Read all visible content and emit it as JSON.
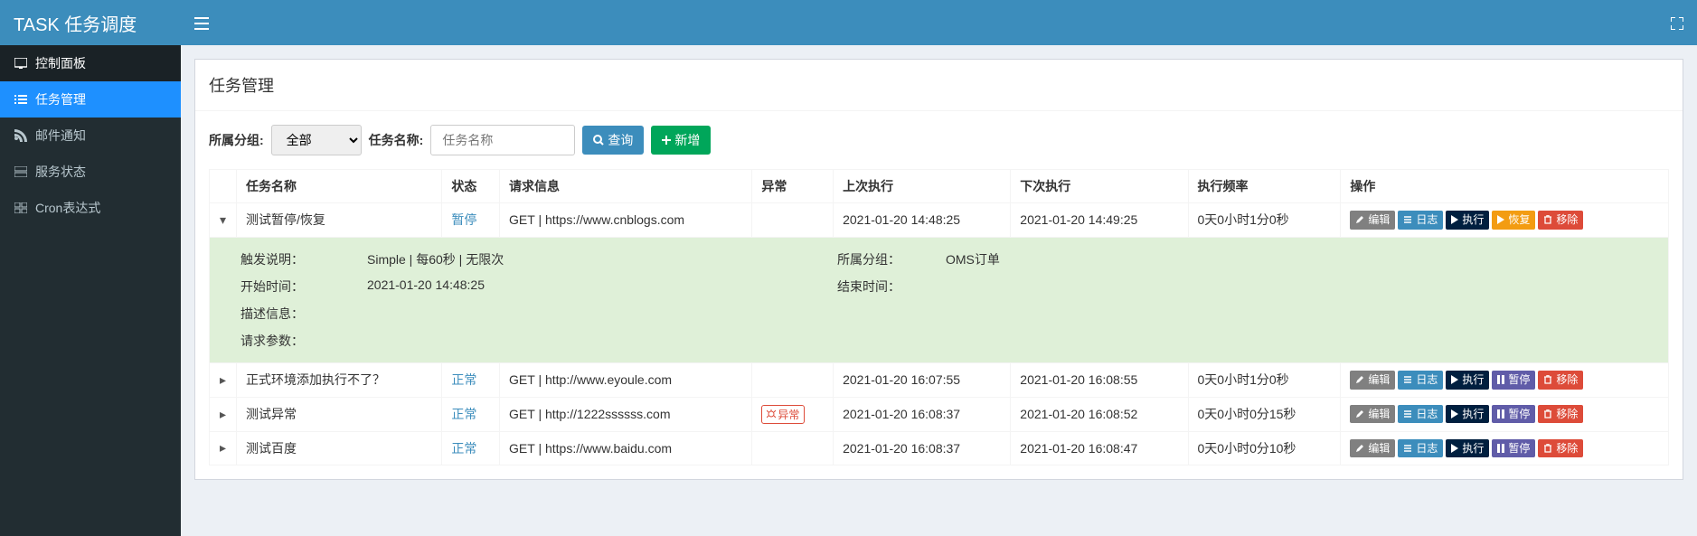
{
  "header": {
    "logo": "TASK 任务调度"
  },
  "sidebar": {
    "home": "控制面板",
    "items": [
      {
        "label": "任务管理"
      },
      {
        "label": "邮件通知"
      },
      {
        "label": "服务状态"
      },
      {
        "label": "Cron表达式"
      }
    ]
  },
  "page": {
    "title": "任务管理",
    "filter": {
      "group_label": "所属分组:",
      "group_value": "全部",
      "name_label": "任务名称:",
      "name_placeholder": "任务名称",
      "query_btn": "查询",
      "add_btn": "新增"
    },
    "table": {
      "headers": {
        "name": "任务名称",
        "status": "状态",
        "request": "请求信息",
        "error": "异常",
        "last": "上次执行",
        "next": "下次执行",
        "freq": "执行频率",
        "ops": "操作"
      }
    },
    "detail_labels": {
      "trigger": "触发说明：",
      "group": "所属分组：",
      "start": "开始时间：",
      "end": "结束时间：",
      "desc": "描述信息：",
      "params": "请求参数："
    },
    "status_text": {
      "pause": "暂停",
      "normal": "正常"
    },
    "err_badge": "异常",
    "op_labels": {
      "edit": "编辑",
      "log": "日志",
      "run": "执行",
      "resume": "恢复",
      "pause": "暂停",
      "delete": "移除"
    },
    "rows": [
      {
        "expanded": true,
        "name": "测试暂停/恢复",
        "status": "pause",
        "request": "GET | https://www.cnblogs.com",
        "error": false,
        "last": "2021-01-20 14:48:25",
        "next": "2021-01-20 14:49:25",
        "freq": "0天0小时1分0秒",
        "ops_variant": "resume",
        "detail": {
          "trigger": "Simple | 每60秒 | 无限次",
          "group": "OMS订单",
          "start": "2021-01-20 14:48:25",
          "end": "",
          "desc": "",
          "params": ""
        }
      },
      {
        "expanded": false,
        "name": "正式环境添加执行不了？",
        "status": "normal",
        "request": "GET | http://www.eyoule.com",
        "error": false,
        "last": "2021-01-20 16:07:55",
        "next": "2021-01-20 16:08:55",
        "freq": "0天0小时1分0秒",
        "ops_variant": "pause"
      },
      {
        "expanded": false,
        "name": "测试异常",
        "status": "normal",
        "request": "GET | http://1222ssssss.com",
        "error": true,
        "last": "2021-01-20 16:08:37",
        "next": "2021-01-20 16:08:52",
        "freq": "0天0小时0分15秒",
        "ops_variant": "pause"
      },
      {
        "expanded": false,
        "name": "测试百度",
        "status": "normal",
        "request": "GET | https://www.baidu.com",
        "error": false,
        "last": "2021-01-20 16:08:37",
        "next": "2021-01-20 16:08:47",
        "freq": "0天0小时0分10秒",
        "ops_variant": "pause"
      }
    ]
  }
}
